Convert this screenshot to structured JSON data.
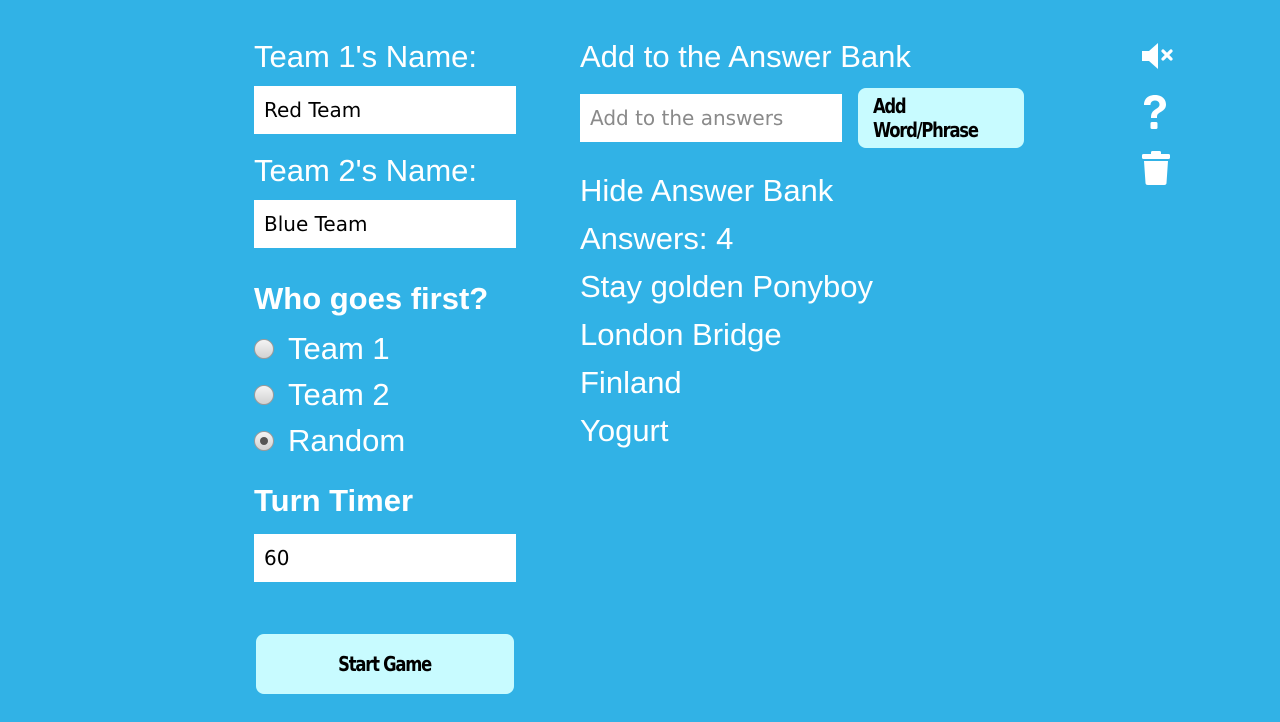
{
  "setup": {
    "team1_label": "Team 1's Name:",
    "team1_value": "Red Team",
    "team2_label": "Team 2's Name:",
    "team2_value": "Blue Team",
    "first_heading": "Who goes first?",
    "first_options": [
      {
        "label": "Team 1",
        "checked": false
      },
      {
        "label": "Team 2",
        "checked": false
      },
      {
        "label": "Random",
        "checked": true
      }
    ],
    "timer_heading": "Turn Timer",
    "timer_value": "60",
    "start_button": "Start Game"
  },
  "answer_bank": {
    "heading": "Add to the Answer Bank",
    "input_placeholder": "Add to the answers",
    "add_button": "Add Word/Phrase",
    "toggle_label": "Hide Answer Bank",
    "count_label": "Answers: 4",
    "items": [
      "Stay golden Ponyboy",
      "London Bridge",
      "Finland",
      "Yogurt"
    ]
  },
  "toolbar": {
    "icons": [
      "mute-icon",
      "help-icon",
      "trash-icon"
    ]
  },
  "colors": {
    "background": "#31b2e6",
    "button": "#c8fbff",
    "text": "#ffffff"
  }
}
